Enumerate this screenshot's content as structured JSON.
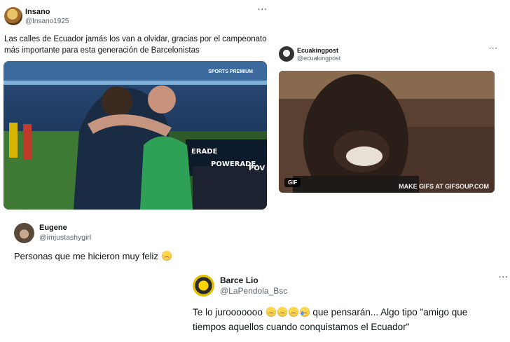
{
  "tweets": [
    {
      "name": "Insano",
      "handle": "@Insano1925",
      "more": "···",
      "text": "Las calles de Ecuador jamás los van a olvidar, gracias por el campeonato más importante para esta generación de Barcelonistas",
      "media": {
        "type": "photo",
        "board_text_1": "ERADE",
        "board_text_2": "POWERADE.",
        "board_text_3": "POV",
        "brand": "SPORTS PREMIUM"
      }
    },
    {
      "name": "Ecuakingpost",
      "handle": "@ecuakingpost",
      "more": "···",
      "media": {
        "type": "gif",
        "badge": "GIF",
        "watermark": "MAKE GIFS AT GIFSOUP.COM"
      }
    },
    {
      "name": "Eugene",
      "handle": "@imjustashygirl",
      "text": "Personas que me hicieron muy feliz"
    },
    {
      "name": "Barce Lio",
      "handle": "@LaPendola_Bsc",
      "more": "···",
      "text_before": "Te lo jurooooooo",
      "text_after": " que pensarán... Algo tipo \"amigo que tiempos aquellos cuando conquistamos el Ecuador\""
    }
  ],
  "colors": {
    "text": "#0f1419",
    "secondary": "#536471",
    "background": "#ffffff"
  }
}
